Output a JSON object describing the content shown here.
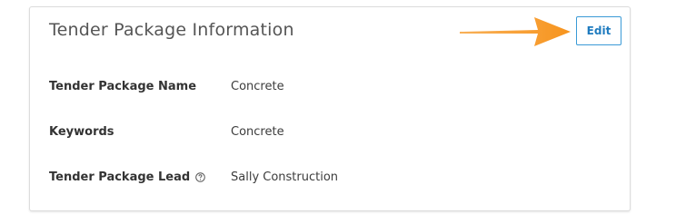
{
  "card": {
    "title": "Tender Package Information",
    "edit_label": "Edit",
    "accent_color": "#3a9ad6",
    "annotation_color": "#f7941d"
  },
  "fields": [
    {
      "label": "Tender Package Name",
      "value": "Concrete"
    },
    {
      "label": "Keywords",
      "value": "Concrete"
    },
    {
      "label": "Tender Package Lead",
      "value": "Sally Construction",
      "icon": "help-circle-icon"
    }
  ]
}
